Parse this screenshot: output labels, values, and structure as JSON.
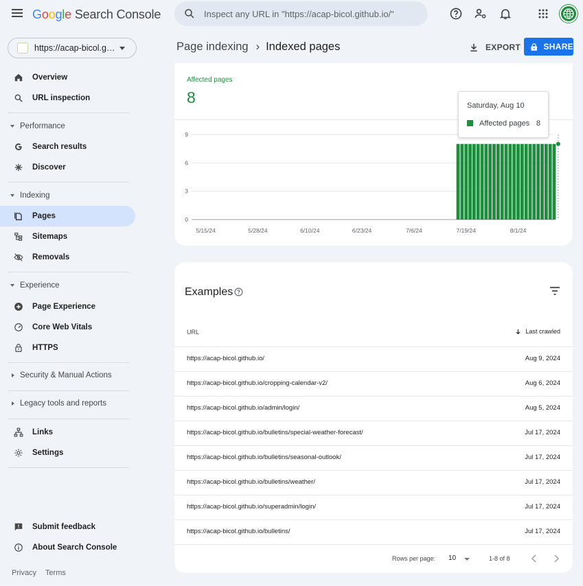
{
  "app": {
    "logo_google": [
      "G",
      "o",
      "o",
      "g",
      "l",
      "e"
    ],
    "logo_product": "Search Console"
  },
  "search": {
    "placeholder": "Inspect any URL in \"https://acap-bicol.github.io/\""
  },
  "property": {
    "url": "https://acap-bicol.github.io/"
  },
  "sidebar": {
    "overview": "Overview",
    "url_inspection": "URL inspection",
    "performance": "Performance",
    "search_results": "Search results",
    "discover": "Discover",
    "indexing": "Indexing",
    "pages": "Pages",
    "sitemaps": "Sitemaps",
    "removals": "Removals",
    "experience": "Experience",
    "page_experience": "Page Experience",
    "core_web_vitals": "Core Web Vitals",
    "https": "HTTPS",
    "security": "Security & Manual Actions",
    "legacy": "Legacy tools and reports",
    "links": "Links",
    "settings": "Settings",
    "submit_feedback": "Submit feedback",
    "about": "About Search Console"
  },
  "footer": {
    "privacy": "Privacy",
    "terms": "Terms"
  },
  "header": {
    "crumb_parent": "Page indexing",
    "crumb_sep": "›",
    "crumb_current": "Indexed pages",
    "export_label": "EXPORT",
    "share_label": "SHARE"
  },
  "summary": {
    "label": "Affected pages",
    "value": "8"
  },
  "tooltip": {
    "date": "Saturday, Aug 10",
    "series": "Affected pages",
    "value": "8"
  },
  "chart_data": {
    "type": "bar",
    "series": [
      {
        "name": "Affected pages",
        "color": "#1e8e3e"
      }
    ],
    "x_tick_labels": [
      "5/15/24",
      "5/28/24",
      "6/10/24",
      "6/23/24",
      "7/6/24",
      "7/19/24",
      "8/1/24"
    ],
    "y_ticks": [
      0,
      3,
      6,
      9
    ],
    "ylim": [
      0,
      9
    ],
    "x_range": [
      "2024-05-13",
      "2024-08-10"
    ],
    "bars_start": "2024-07-17",
    "bars_end": "2024-08-10",
    "bar_value": 8,
    "grid": true
  },
  "examples": {
    "title": "Examples",
    "col_url": "URL",
    "col_crawled": "Last crawled",
    "rows": [
      {
        "url": "https://acap-bicol.github.io/",
        "date": "Aug 9, 2024"
      },
      {
        "url": "https://acap-bicol.github.io/cropping-calendar-v2/",
        "date": "Aug 6, 2024"
      },
      {
        "url": "https://acap-bicol.github.io/admin/login/",
        "date": "Aug 5, 2024"
      },
      {
        "url": "https://acap-bicol.github.io/bulletins/special-weather-forecast/",
        "date": "Jul 17, 2024"
      },
      {
        "url": "https://acap-bicol.github.io/bulletins/seasonal-outlook/",
        "date": "Jul 17, 2024"
      },
      {
        "url": "https://acap-bicol.github.io/bulletins/weather/",
        "date": "Jul 17, 2024"
      },
      {
        "url": "https://acap-bicol.github.io/superadmin/login/",
        "date": "Jul 17, 2024"
      },
      {
        "url": "https://acap-bicol.github.io/bulletins/",
        "date": "Jul 17, 2024"
      }
    ],
    "rows_per_page_label": "Rows per page:",
    "rows_per_page_value": "10",
    "range": "1-8 of 8"
  }
}
